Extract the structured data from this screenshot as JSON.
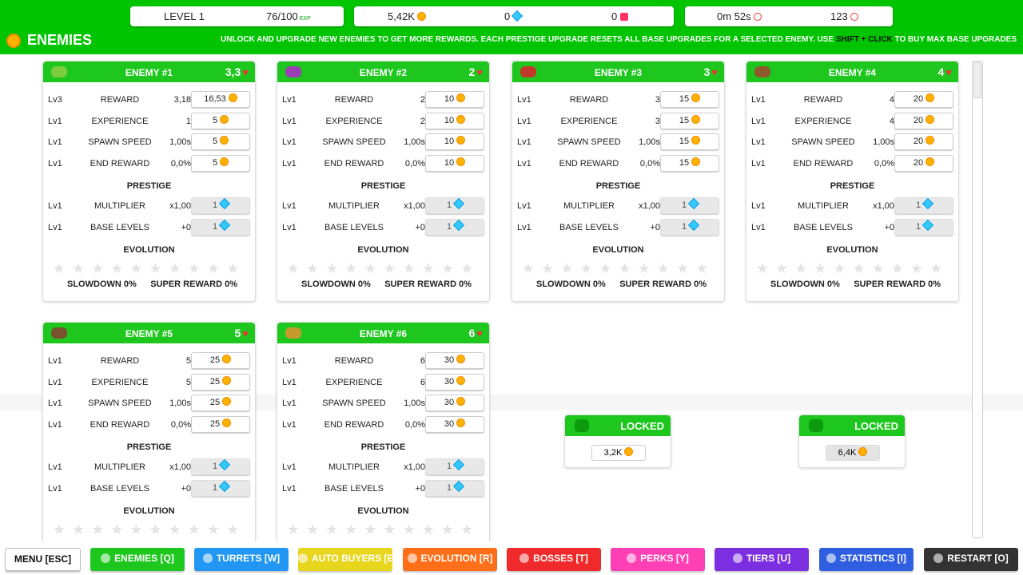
{
  "stats": {
    "level_label": "LEVEL 1",
    "exp": "76/100",
    "exp_icon": "EXP",
    "coins": "5,42K",
    "gems": "0",
    "rubies": "0",
    "time": "0m 52s",
    "kills": "123"
  },
  "header": {
    "title": "ENEMIES",
    "description_pre": "UNLOCK AND UPGRADE NEW ENEMIES TO GET MORE REWARDS. EACH PRESTIGE UPGRADE RESETS ALL BASE UPGRADES FOR A SELECTED ENEMY. USE ",
    "description_key": "SHIFT + CLICK",
    "description_post": " TO BUY MAX BASE UPGRADES"
  },
  "labels": {
    "reward": "REWARD",
    "experience": "EXPERIENCE",
    "spawn_speed": "SPAWN SPEED",
    "end_reward": "END REWARD",
    "prestige": "PRESTIGE",
    "multiplier": "MULTIPLIER",
    "base_levels": "BASE LEVELS",
    "evolution": "EVOLUTION",
    "slowdown": "SLOWDOWN 0%",
    "super_reward": "SUPER REWARD 0%",
    "locked": "LOCKED"
  },
  "enemies": [
    {
      "name": "ENEMY #1",
      "hp": "3,3",
      "color": "#7ccd3c",
      "reward": {
        "lv": "Lv3",
        "val": "3,18",
        "cost": "16,53"
      },
      "experience": {
        "lv": "Lv1",
        "val": "1",
        "cost": "5"
      },
      "spawn": {
        "lv": "Lv1",
        "val": "1,00s",
        "cost": "5"
      },
      "end": {
        "lv": "Lv1",
        "val": "0,0%",
        "cost": "5"
      },
      "multiplier": {
        "lv": "Lv1",
        "val": "x1,00",
        "cost": "1"
      },
      "base": {
        "lv": "Lv1",
        "val": "+0",
        "cost": "1"
      }
    },
    {
      "name": "ENEMY #2",
      "hp": "2",
      "color": "#9b3fb5",
      "reward": {
        "lv": "Lv1",
        "val": "2",
        "cost": "10"
      },
      "experience": {
        "lv": "Lv1",
        "val": "2",
        "cost": "10"
      },
      "spawn": {
        "lv": "Lv1",
        "val": "1,00s",
        "cost": "10"
      },
      "end": {
        "lv": "Lv1",
        "val": "0,0%",
        "cost": "10"
      },
      "multiplier": {
        "lv": "Lv1",
        "val": "x1,00",
        "cost": "1"
      },
      "base": {
        "lv": "Lv1",
        "val": "+0",
        "cost": "1"
      }
    },
    {
      "name": "ENEMY #3",
      "hp": "3",
      "color": "#c0392b",
      "reward": {
        "lv": "Lv1",
        "val": "3",
        "cost": "15"
      },
      "experience": {
        "lv": "Lv1",
        "val": "3",
        "cost": "15"
      },
      "spawn": {
        "lv": "Lv1",
        "val": "1,00s",
        "cost": "15"
      },
      "end": {
        "lv": "Lv1",
        "val": "0,0%",
        "cost": "15"
      },
      "multiplier": {
        "lv": "Lv1",
        "val": "x1,00",
        "cost": "1"
      },
      "base": {
        "lv": "Lv1",
        "val": "+0",
        "cost": "1"
      }
    },
    {
      "name": "ENEMY #4",
      "hp": "4",
      "color": "#8d5a2b",
      "reward": {
        "lv": "Lv1",
        "val": "4",
        "cost": "20"
      },
      "experience": {
        "lv": "Lv1",
        "val": "4",
        "cost": "20"
      },
      "spawn": {
        "lv": "Lv1",
        "val": "1,00s",
        "cost": "20"
      },
      "end": {
        "lv": "Lv1",
        "val": "0,0%",
        "cost": "20"
      },
      "multiplier": {
        "lv": "Lv1",
        "val": "x1,00",
        "cost": "1"
      },
      "base": {
        "lv": "Lv1",
        "val": "+0",
        "cost": "1"
      }
    },
    {
      "name": "ENEMY #5",
      "hp": "5",
      "color": "#7a5230",
      "reward": {
        "lv": "Lv1",
        "val": "5",
        "cost": "25"
      },
      "experience": {
        "lv": "Lv1",
        "val": "5",
        "cost": "25"
      },
      "spawn": {
        "lv": "Lv1",
        "val": "1,00s",
        "cost": "25"
      },
      "end": {
        "lv": "Lv1",
        "val": "0,0%",
        "cost": "25"
      },
      "multiplier": {
        "lv": "Lv1",
        "val": "x1,00",
        "cost": "1"
      },
      "base": {
        "lv": "Lv1",
        "val": "+0",
        "cost": "1"
      }
    },
    {
      "name": "ENEMY #6",
      "hp": "6",
      "color": "#c79a2e",
      "reward": {
        "lv": "Lv1",
        "val": "6",
        "cost": "30"
      },
      "experience": {
        "lv": "Lv1",
        "val": "6",
        "cost": "30"
      },
      "spawn": {
        "lv": "Lv1",
        "val": "1,00s",
        "cost": "30"
      },
      "end": {
        "lv": "Lv1",
        "val": "0,0%",
        "cost": "30"
      },
      "multiplier": {
        "lv": "Lv1",
        "val": "x1,00",
        "cost": "1"
      },
      "base": {
        "lv": "Lv1",
        "val": "+0",
        "cost": "1"
      }
    }
  ],
  "locked": [
    {
      "cost": "3,2K"
    },
    {
      "cost": "6,4K"
    }
  ],
  "nav": [
    {
      "label": "MENU [ESC]",
      "color": "#ffffff",
      "text": "#111111",
      "icon": ""
    },
    {
      "label": "ENEMIES [Q]",
      "color": "#1ec71e",
      "text": "#ffffff",
      "icon": "coin-icon"
    },
    {
      "label": "TURRETS [W]",
      "color": "#2196f3",
      "text": "#ffffff",
      "icon": "swords-icon"
    },
    {
      "label": "AUTO BUYERS [E]",
      "color": "#e8d51e",
      "text": "#ffffff",
      "icon": "clock-icon"
    },
    {
      "label": "EVOLUTION [R]",
      "color": "#ff6f1a",
      "text": "#ffffff",
      "icon": "star-icon"
    },
    {
      "label": "BOSSES [T]",
      "color": "#f02a2a",
      "text": "#ffffff",
      "icon": "skull-icon"
    },
    {
      "label": "PERKS [Y]",
      "color": "#ff3fb4",
      "text": "#ffffff",
      "icon": "perk-icon"
    },
    {
      "label": "TIERS [U]",
      "color": "#7b2fe0",
      "text": "#ffffff",
      "icon": "pyramid-icon"
    },
    {
      "label": "STATISTICS [I]",
      "color": "#2f5fe0",
      "text": "#ffffff",
      "icon": "chart-icon"
    },
    {
      "label": "RESTART [O]",
      "color": "#333333",
      "text": "#ffffff",
      "icon": "restart-icon"
    }
  ]
}
